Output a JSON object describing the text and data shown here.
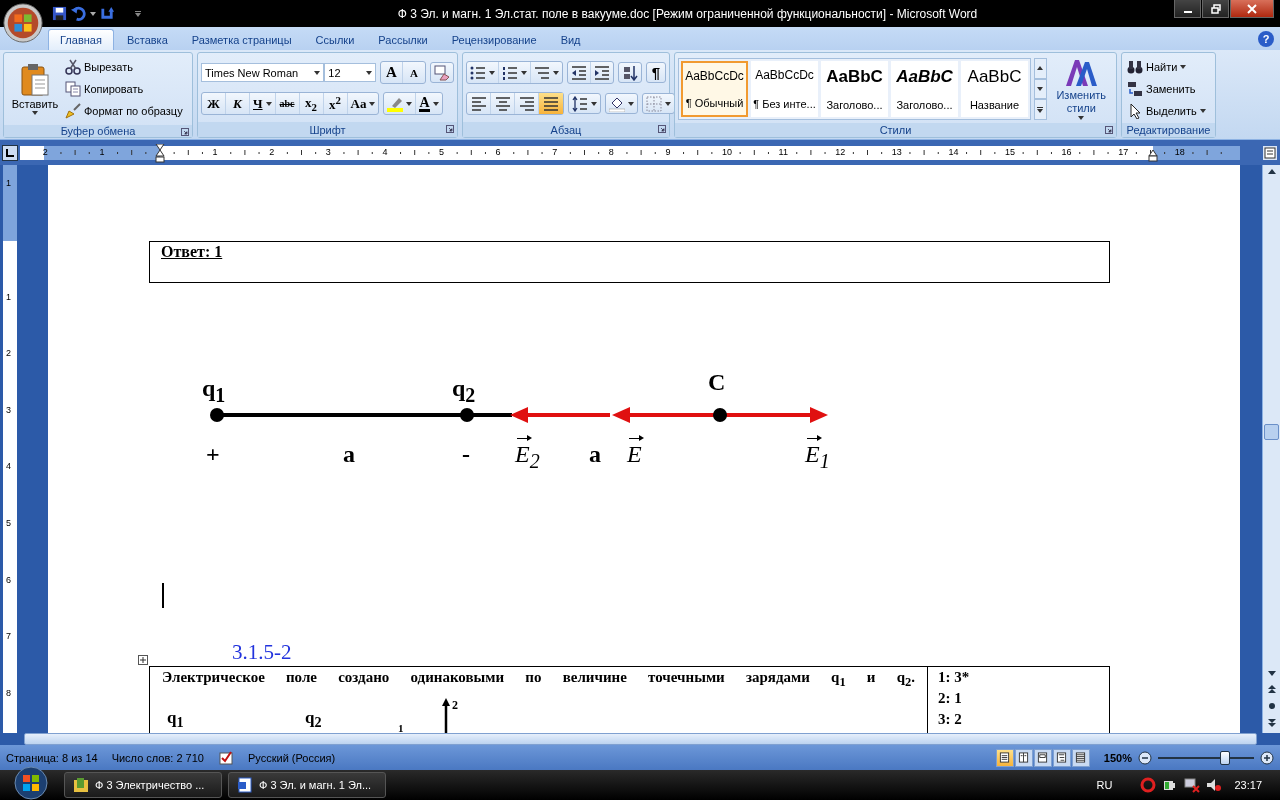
{
  "window": {
    "title": "Ф 3 Эл. и магн. 1 Эл.стат. поле в вакууме.doc [Режим ограниченной функциональности] - Microsoft Word"
  },
  "ribbon_tabs": [
    {
      "label": "Главная",
      "selected": true
    },
    {
      "label": "Вставка",
      "selected": false
    },
    {
      "label": "Разметка страницы",
      "selected": false
    },
    {
      "label": "Ссылки",
      "selected": false
    },
    {
      "label": "Рассылки",
      "selected": false
    },
    {
      "label": "Рецензирование",
      "selected": false
    },
    {
      "label": "Вид",
      "selected": false
    }
  ],
  "help": "?",
  "clipboard": {
    "group": "Буфер обмена",
    "paste": "Вставить",
    "items": [
      {
        "label": "Вырезать",
        "kind": "cut"
      },
      {
        "label": "Копировать",
        "kind": "copy"
      },
      {
        "label": "Формат по образцу",
        "kind": "brush"
      }
    ]
  },
  "font": {
    "group": "Шрифт",
    "name": "Times New Roman",
    "size": "12",
    "resize": [
      {
        "label": "A",
        "kind": "grow"
      },
      {
        "label": "A",
        "kind": "shrink"
      }
    ],
    "format_buttons": [
      {
        "label": "Ж",
        "kind": "bold"
      },
      {
        "label": "К",
        "kind": "italic"
      },
      {
        "label": "Ч",
        "kind": "underline"
      },
      {
        "label": "abc",
        "kind": "strike"
      },
      {
        "label": "x$_{2}$",
        "kind": "subscript"
      },
      {
        "label": "x$^{2}$",
        "kind": "superscript"
      },
      {
        "label": "Aa",
        "kind": "case"
      }
    ],
    "color_button": "A"
  },
  "paragraph": {
    "group": "Абзац",
    "pilcrow": "¶",
    "alignments": [
      {
        "kind": "left",
        "selected": false
      },
      {
        "kind": "center",
        "selected": false
      },
      {
        "kind": "right",
        "selected": false
      },
      {
        "kind": "justify",
        "selected": true
      }
    ]
  },
  "styles": {
    "group": "Стили",
    "change": "Изменить стили",
    "tiles": [
      {
        "preview": "AaBbCcDc",
        "name": "¶ Обычный",
        "kind": "normal",
        "selected": true
      },
      {
        "preview": "AaBbCcDc",
        "name": "¶ Без инте...",
        "kind": "normal",
        "selected": false
      },
      {
        "preview": "AaBbC",
        "name": "Заголово...",
        "kind": "heading",
        "selected": false
      },
      {
        "preview": "AaBbC",
        "name": "Заголово...",
        "kind": "heading-italic",
        "selected": false
      },
      {
        "preview": "AaBbC",
        "name": "Название",
        "kind": "title",
        "selected": false
      }
    ]
  },
  "editing": {
    "group": "Редактирование",
    "items": [
      {
        "label": "Найти",
        "kind": "find"
      },
      {
        "label": "Заменить",
        "kind": "replace"
      },
      {
        "label": "Выделить",
        "kind": "select"
      }
    ]
  },
  "ruler": {
    "left_numbers": [
      "2",
      "1"
    ],
    "numbers": [
      "1",
      "2",
      "3",
      "4",
      "5",
      "6",
      "7",
      "8",
      "9",
      "10",
      "11",
      "12",
      "13",
      "14",
      "15",
      "16",
      "17",
      "18"
    ]
  },
  "vertical_ruler": {
    "top_numbers": [
      "1"
    ],
    "numbers": [
      "1",
      "2",
      "3",
      "4",
      "5",
      "6",
      "7",
      "8"
    ]
  },
  "document": {
    "answer": "Ответ: 1",
    "diagram": {
      "charges": [
        {
          "label": "q$_{1}$",
          "sign": "+"
        },
        {
          "label": "q$_{2}$",
          "sign": "-"
        }
      ],
      "point": "C",
      "distances": [
        "a",
        "a"
      ],
      "vectors": [
        "E$_{2}$",
        "E",
        "E$_{1}$"
      ]
    },
    "task": {
      "number": "3.1.5-2",
      "question": "Электрическое поле создано одинаковыми по величине точечными зарядами q$_{1}$ и q$_{2}$.",
      "figure_labels": [
        "q$_{1}$",
        "q$_{2}$",
        "1",
        "2"
      ],
      "answers": [
        "1: 3*",
        "2: 1",
        "3: 2"
      ]
    }
  },
  "status_bar": {
    "page": "Страница: 8 из 14",
    "words": "Число слов: 2 710",
    "language": "Русский (Россия)",
    "views": [
      {
        "kind": "print",
        "selected": true
      },
      {
        "kind": "reading",
        "selected": false
      },
      {
        "kind": "web",
        "selected": false
      },
      {
        "kind": "outline",
        "selected": false
      },
      {
        "kind": "draft",
        "selected": false
      }
    ],
    "zoom": {
      "label": "150%",
      "level": 0.7
    }
  },
  "taskbar": {
    "buttons": [
      {
        "label": "Ф 3 Электричество ...",
        "kind": "folder"
      },
      {
        "label": "Ф 3 Эл. и магн. 1 Эл...",
        "kind": "word"
      }
    ],
    "language": "RU",
    "clock": "23:17"
  }
}
